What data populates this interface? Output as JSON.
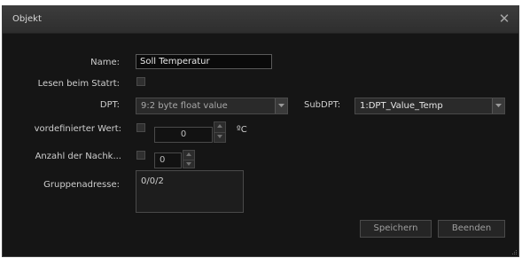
{
  "dialog": {
    "title": "Objekt",
    "close_glyph": "✕"
  },
  "form": {
    "name_label": "Name:",
    "name_value": "Soll Temperatur",
    "read_on_start_label": "Lesen beim Statrt:",
    "read_on_start_checked": false,
    "dpt_label": "DPT:",
    "dpt_value": "9:2 byte float value",
    "subdpt_label": "SubDPT:",
    "subdpt_value": "1:DPT_Value_Temp",
    "predefined_label": "vordefinierter Wert:",
    "predefined_checked": false,
    "predefined_value": "0",
    "predefined_unit": "ºC",
    "count_label": "Anzahl der Nachk...",
    "count_checked": false,
    "count_value": "0",
    "group_address_label": "Gruppenadresse:",
    "group_address_value": "0/0/2"
  },
  "buttons": {
    "save": "Speichern",
    "close": "Beenden"
  },
  "colors": {
    "background": "#151515",
    "titlebar": "#353535",
    "text": "#cfcfcf"
  },
  "icons": [
    "close-icon",
    "chevron-down-icon",
    "chevron-up-icon",
    "resize-grip-icon"
  ]
}
